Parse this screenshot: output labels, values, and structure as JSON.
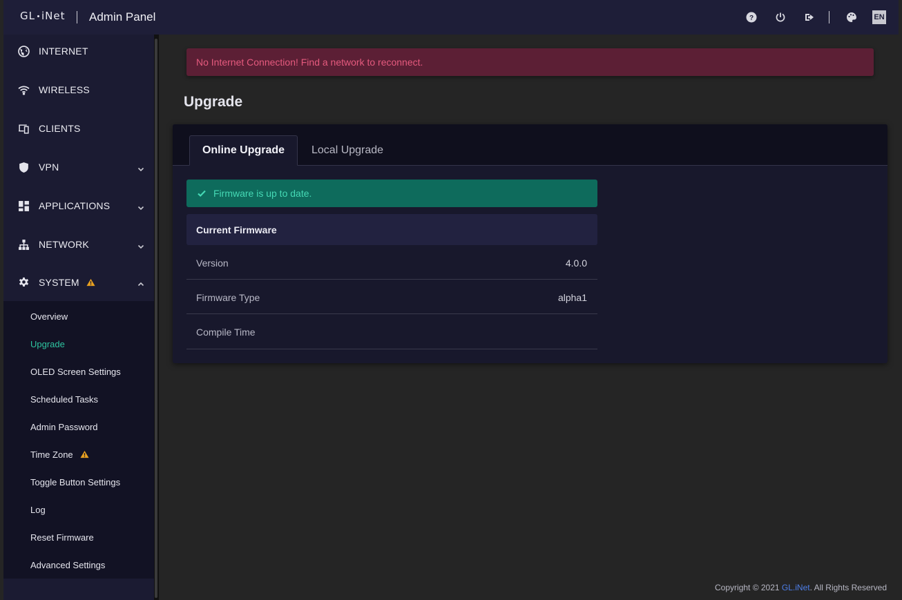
{
  "header": {
    "logo_left": "GL",
    "logo_right": "iNet",
    "title": "Admin Panel",
    "icons": [
      "help-icon",
      "power-icon",
      "logout-icon",
      "theme-palette-icon"
    ],
    "language": "EN"
  },
  "sidebar": {
    "items": [
      {
        "label": "INTERNET",
        "icon": "globe-icon"
      },
      {
        "label": "WIRELESS",
        "icon": "wifi-icon"
      },
      {
        "label": "CLIENTS",
        "icon": "devices-icon"
      },
      {
        "label": "VPN",
        "icon": "shield-icon"
      },
      {
        "label": "APPLICATIONS",
        "icon": "apps-grid-icon"
      },
      {
        "label": "NETWORK",
        "icon": "network-tree-icon"
      },
      {
        "label": "SYSTEM",
        "icon": "gear-icon"
      }
    ],
    "submenu": [
      {
        "label": "Overview"
      },
      {
        "label": "Upgrade"
      },
      {
        "label": "OLED Screen Settings"
      },
      {
        "label": "Scheduled Tasks"
      },
      {
        "label": "Admin Password"
      },
      {
        "label": "Time Zone"
      },
      {
        "label": "Toggle Button Settings"
      },
      {
        "label": "Log"
      },
      {
        "label": "Reset Firmware"
      },
      {
        "label": "Advanced Settings"
      }
    ]
  },
  "alert": {
    "text": "No Internet Connection! Find a network to reconnect."
  },
  "page": {
    "title": "Upgrade"
  },
  "tabs": [
    {
      "label": "Online Upgrade",
      "active": true
    },
    {
      "label": "Local Upgrade",
      "active": false
    }
  ],
  "status": {
    "text": "Firmware is up to date."
  },
  "firmware": {
    "heading": "Current Firmware",
    "rows": [
      {
        "key": "Version",
        "value": "4.0.0"
      },
      {
        "key": "Firmware Type",
        "value": "alpha1"
      },
      {
        "key": "Compile Time",
        "value": ""
      }
    ]
  },
  "footer": {
    "prefix": "Copyright © 2021 ",
    "brand": "GL.iNet",
    "suffix": ". All Rights Reserved"
  },
  "colors": {
    "accent": "#2ec4a0",
    "alert_bg": "#5c1f35",
    "alert_text": "#e55a7e",
    "success_bg": "#0e6b5c",
    "warning": "#e8a020",
    "brand_link": "#4d7ee8"
  }
}
